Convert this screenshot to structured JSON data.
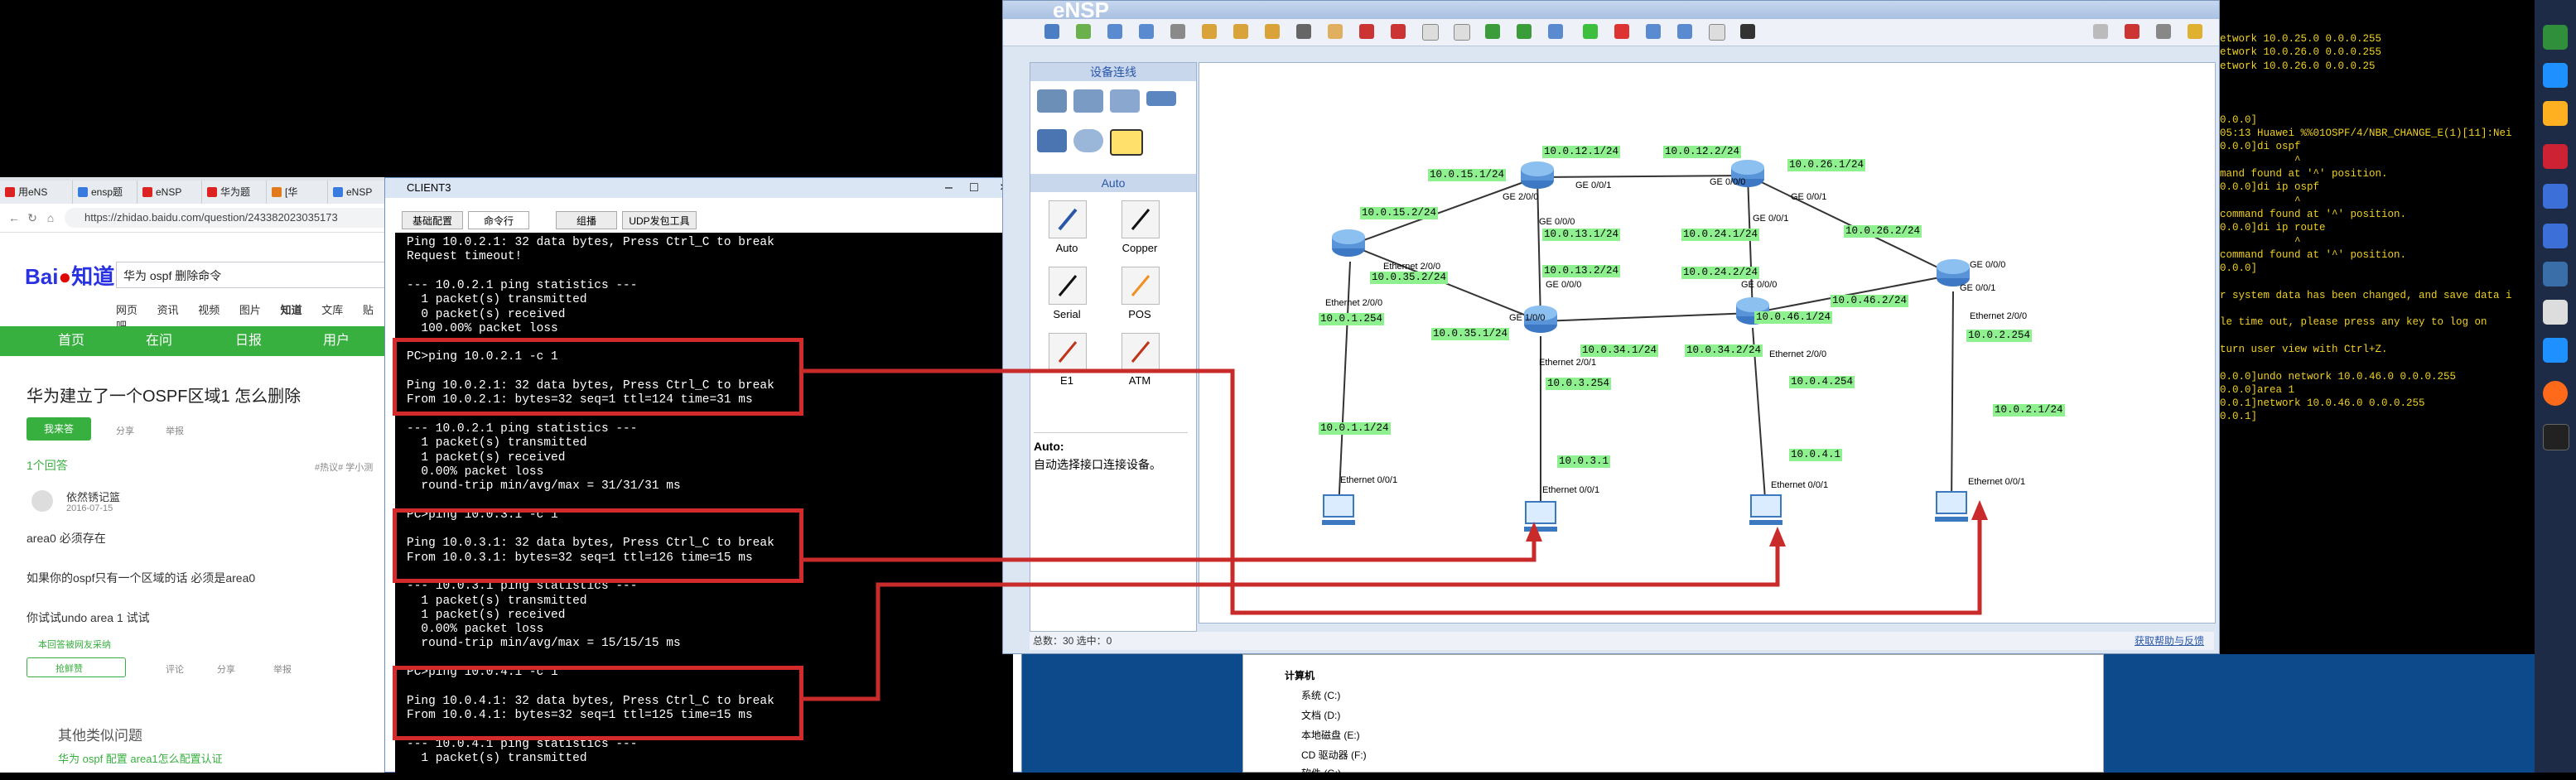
{
  "browser": {
    "tabs": [
      "用eNS",
      "ensp题",
      "eNSP",
      "华为题",
      "[华",
      "eNSP"
    ],
    "url": "https://zhidao.baidu.com/question/243382023035173",
    "logo_text": "Bai",
    "logo_suffix": "知道",
    "search_text": "华为 ospf 删除命令",
    "categories": [
      "网页",
      "资讯",
      "视频",
      "图片",
      "知道",
      "文库",
      "贴吧"
    ],
    "green_nav": [
      "首页",
      "在问",
      "日报",
      "用户"
    ],
    "question_title": "华为建立了一个OSPF区域1 怎么删除",
    "answer_btn": "我来答",
    "share": "分享",
    "report": "举报",
    "answer_count": "1个回答",
    "hot_tag": "#热议# 学小测",
    "answerer": "依然锈记篮",
    "date": "2016-07-15",
    "answer_lines": [
      "area0 必须存在",
      "如果你的ospf只有一个区域的话 必须是area0",
      "你试试undo area 1 试试"
    ],
    "verified": "本回答被网友采纳",
    "likes": "抢鲜赞",
    "comment": "评论",
    "share2": "分享",
    "report2": "举报",
    "other_q": "其他类似问题",
    "related": "华为 ospf 配置 area1怎么配置认证"
  },
  "client3": {
    "title": "CLIENT3",
    "tabs": [
      "基础配置",
      "命令行",
      "组播",
      "UDP发包工具"
    ],
    "lines": [
      "Ping 10.0.2.1: 32 data bytes, Press Ctrl_C to break",
      "Request timeout!",
      "",
      "--- 10.0.2.1 ping statistics ---",
      "  1 packet(s) transmitted",
      "  0 packet(s) received",
      "  100.00% packet loss",
      "",
      "PC>ping 10.0.2.1 -c 1",
      "",
      "Ping 10.0.2.1: 32 data bytes, Press Ctrl_C to break",
      "From 10.0.2.1: bytes=32 seq=1 ttl=124 time=31 ms",
      "",
      "--- 10.0.2.1 ping statistics ---",
      "  1 packet(s) transmitted",
      "  1 packet(s) received",
      "  0.00% packet loss",
      "  round-trip min/avg/max = 31/31/31 ms",
      "",
      "PC>ping 10.0.3.1 -c 1",
      "",
      "Ping 10.0.3.1: 32 data bytes, Press Ctrl_C to break",
      "From 10.0.3.1: bytes=32 seq=1 ttl=126 time=15 ms",
      "",
      "--- 10.0.3.1 ping statistics ---",
      "  1 packet(s) transmitted",
      "  1 packet(s) received",
      "  0.00% packet loss",
      "  round-trip min/avg/max = 15/15/15 ms",
      "",
      "PC>ping 10.0.4.1 -c 1",
      "",
      "Ping 10.0.4.1: 32 data bytes, Press Ctrl_C to break",
      "From 10.0.4.1: bytes=32 seq=1 ttl=125 time=15 ms",
      "",
      "--- 10.0.4.1 ping statistics ---",
      "  1 packet(s) transmitted"
    ]
  },
  "ensp": {
    "title": "eNSP",
    "panel_title": "设备连线",
    "auto_head": "Auto",
    "cables": [
      "Auto",
      "Copper",
      "Serial",
      "POS",
      "E1",
      "ATM"
    ],
    "auto_desc_title": "Auto:",
    "auto_desc": "自动选择接口连接设备。",
    "status_left": "总数：30  选中：0",
    "status_right": "获取帮助与反馈",
    "labels": [
      "10.0.12.1/24",
      "10.0.12.2/24",
      "10.0.26.1/24",
      "10.0.15.1/24",
      "10.0.15.2/24",
      "10.0.13.1/24",
      "10.0.24.1/24",
      "10.0.26.2/24",
      "10.0.35.2/24",
      "10.0.13.2/24",
      "10.0.24.2/24",
      "10.0.46.2/24",
      "10.0.46.1/24",
      "10.0.1.254",
      "10.0.35.1/24",
      "10.0.34.1/24",
      "10.0.34.2/24",
      "10.0.2.254",
      "10.0.3.254",
      "10.0.4.254",
      "10.0.2.1/24",
      "10.0.1.1/24",
      "10.0.3.1",
      "10.0.4.1"
    ],
    "ports": [
      "GE 2/0/0",
      "GE 0/0/1",
      "GE 0/0/0",
      "GE 0/0/1",
      "GE 0/0/0",
      "GE 0/0/1",
      "GE 0/0/0",
      "GE 0/0/0",
      "Ethernet 2/0/0",
      "GE 1/0/0",
      "GE 0/0/0",
      "GE 0/0/1",
      "Ethernet 2/0/1",
      "Ethernet 2/0/0",
      "Ethernet 2/0/0",
      "Ethernet 2/0/0",
      "Ethernet 0/0/1",
      "Ethernet 0/0/1",
      "Ethernet 0/0/1",
      "Ethernet 0/0/1"
    ]
  },
  "console": {
    "lines": [
      "etwork 10.0.25.0 0.0.0.255",
      "etwork 10.0.26.0 0.0.0.255",
      "etwork 10.0.26.0 0.0.0.25",
      "",
      "",
      "",
      "0.0.0]",
      "05:13 Huawei %%01OSPF/4/NBR_CHANGE_E(1)[11]:Nei",
      "0.0.0]di ospf",
      "            ^",
      "mand found at '^' position.",
      "0.0.0]di ip ospf",
      "            ^",
      "command found at '^' position.",
      "0.0.0]di ip route",
      "            ^",
      "command found at '^' position.",
      "0.0.0]",
      "",
      "r system data has been changed, and save data i",
      "",
      "le time out, please press any key to log on",
      "",
      "turn user view with Ctrl+Z.",
      "",
      "0.0.0]undo network 10.0.46.0 0.0.0.255",
      "0.0.0]area 1",
      "0.0.1]network 10.0.46.0 0.0.0.255",
      "0.0.1]"
    ]
  },
  "explorer": {
    "items": [
      "计算机",
      "系统 (C:)",
      "文档 (D:)",
      "本地磁盘 (E:)",
      "CD 驱动器 (F:)",
      "软件 (G:)"
    ]
  },
  "colors": {
    "accent_green": "#38b03f",
    "label_green": "#8ff08f",
    "redbox": "#d32b2b",
    "term_bg": "#000000"
  }
}
